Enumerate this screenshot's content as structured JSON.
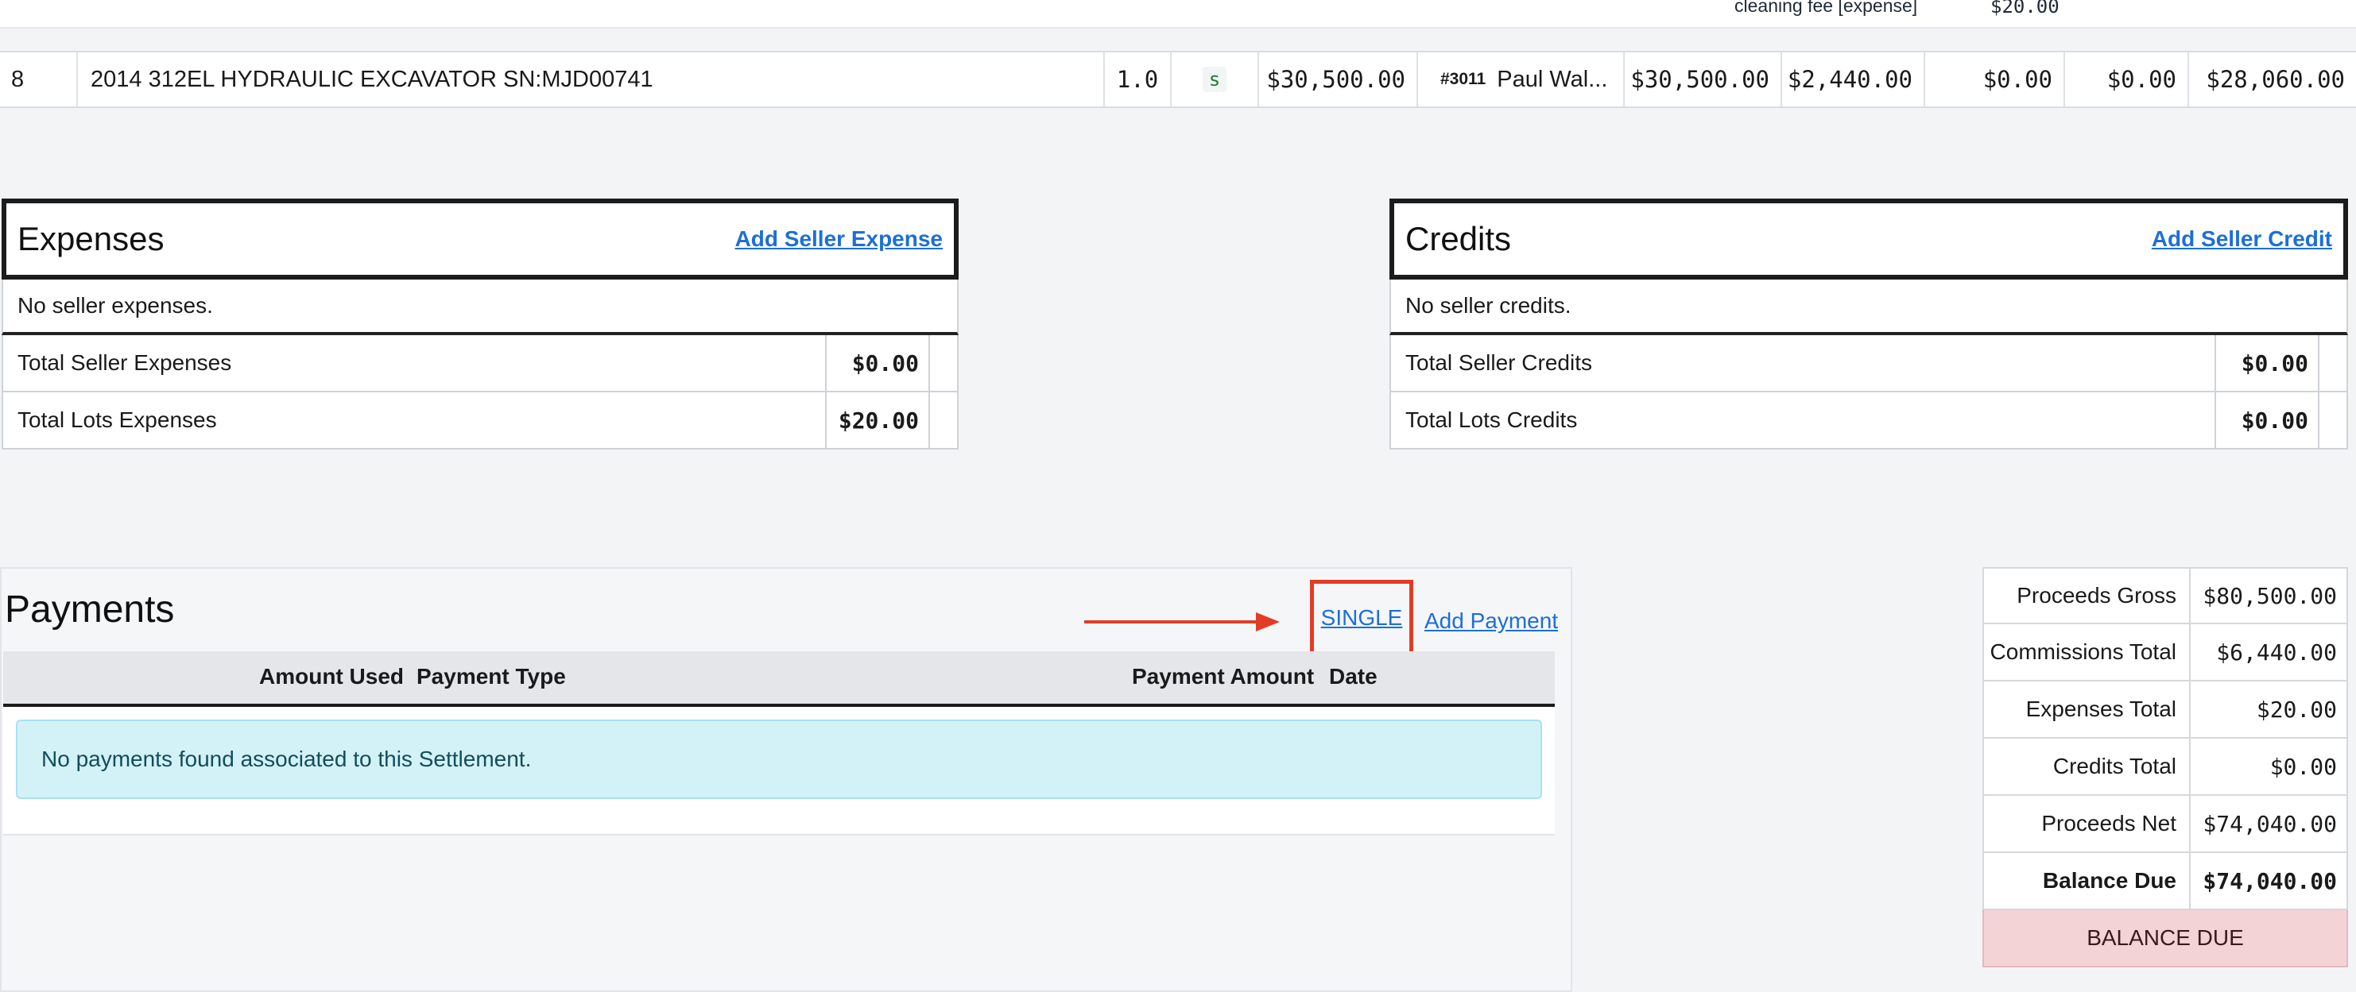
{
  "lots": {
    "prev_row": {
      "fee_label": "cleaning fee [expense]",
      "fee_amount": "$20.00"
    },
    "row": {
      "lot_number": "8",
      "description": "2014 312EL HYDRAULIC EXCAVATOR SN:MJD00741",
      "quantity": "1.0",
      "status_badge": "s",
      "price": "$30,500.00",
      "buyer_number": "#3011",
      "buyer_name": "Paul Wal...",
      "gross": "$30,500.00",
      "commission": "$2,440.00",
      "expenses": "$0.00",
      "credits": "$0.00",
      "net": "$28,060.00"
    }
  },
  "expenses": {
    "title": "Expenses",
    "add_link": "Add Seller Expense",
    "empty_text": "No seller expenses.",
    "rows": [
      {
        "label": "Total Seller Expenses",
        "value": "$0.00"
      },
      {
        "label": "Total Lots Expenses",
        "value": "$20.00"
      }
    ]
  },
  "credits": {
    "title": "Credits",
    "add_link": "Add Seller Credit",
    "empty_text": "No seller credits.",
    "rows": [
      {
        "label": "Total Seller Credits",
        "value": "$0.00"
      },
      {
        "label": "Total Lots Credits",
        "value": "$0.00"
      }
    ]
  },
  "payments": {
    "title": "Payments",
    "single_link": "SINGLE",
    "add_link": "Add Payment",
    "columns": [
      "Amount Used",
      "Payment Type",
      "Payment Amount",
      "Date"
    ],
    "empty_text": "No payments found associated to this Settlement."
  },
  "summary": {
    "rows": [
      {
        "label": "Proceeds Gross",
        "value": "$80,500.00"
      },
      {
        "label": "Commissions Total",
        "value": "$6,440.00"
      },
      {
        "label": "Expenses Total",
        "value": "$20.00"
      },
      {
        "label": "Credits Total",
        "value": "$0.00"
      },
      {
        "label": "Proceeds Net",
        "value": "$74,040.00"
      },
      {
        "label": "Balance Due",
        "value": "$74,040.00"
      }
    ],
    "status_badge": "BALANCE DUE"
  },
  "colors": {
    "link": "#1d6fd8",
    "highlight": "#e23b26",
    "alert_bg": "#d3f2f8",
    "balance_badge_bg": "#f4d3d6"
  }
}
